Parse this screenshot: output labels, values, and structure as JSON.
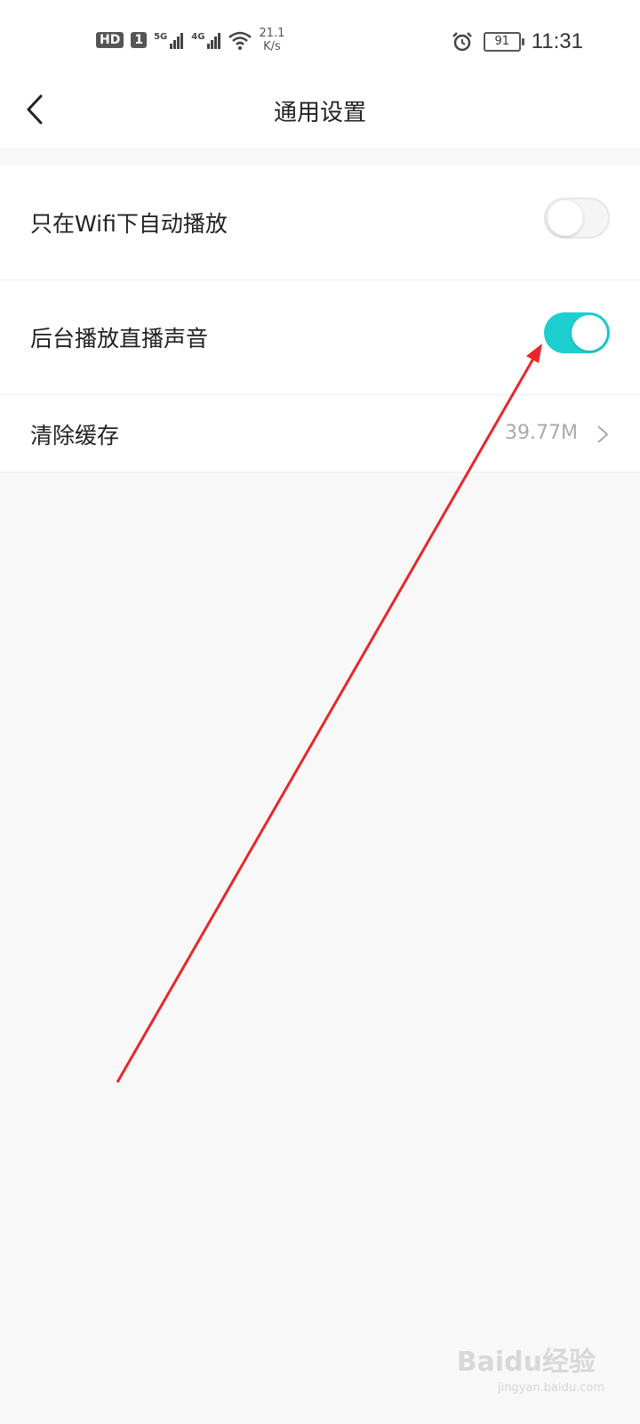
{
  "status_bar": {
    "hd": "HD",
    "sim": "1",
    "net1": "5G",
    "net2": "4G",
    "speed_value": "21.1",
    "speed_unit": "K/s",
    "battery": "91",
    "time": "11:31",
    "icons": [
      "signal-icon",
      "wifi-icon",
      "alarm-icon",
      "battery-icon"
    ]
  },
  "header": {
    "title": "通用设置",
    "back_icon": "back-arrow-icon"
  },
  "settings": {
    "wifi_autoplay": {
      "label": "只在Wifi下自动播放",
      "enabled": false
    },
    "background_audio": {
      "label": "后台播放直播声音",
      "enabled": true
    },
    "clear_cache": {
      "label": "清除缓存",
      "value": "39.77M"
    }
  },
  "colors": {
    "toggle_on": "#1dcfcf",
    "annotation_arrow": "#e8262a"
  },
  "watermark": {
    "brand": "Baidu经验",
    "url": "jingyan.baidu.com"
  }
}
